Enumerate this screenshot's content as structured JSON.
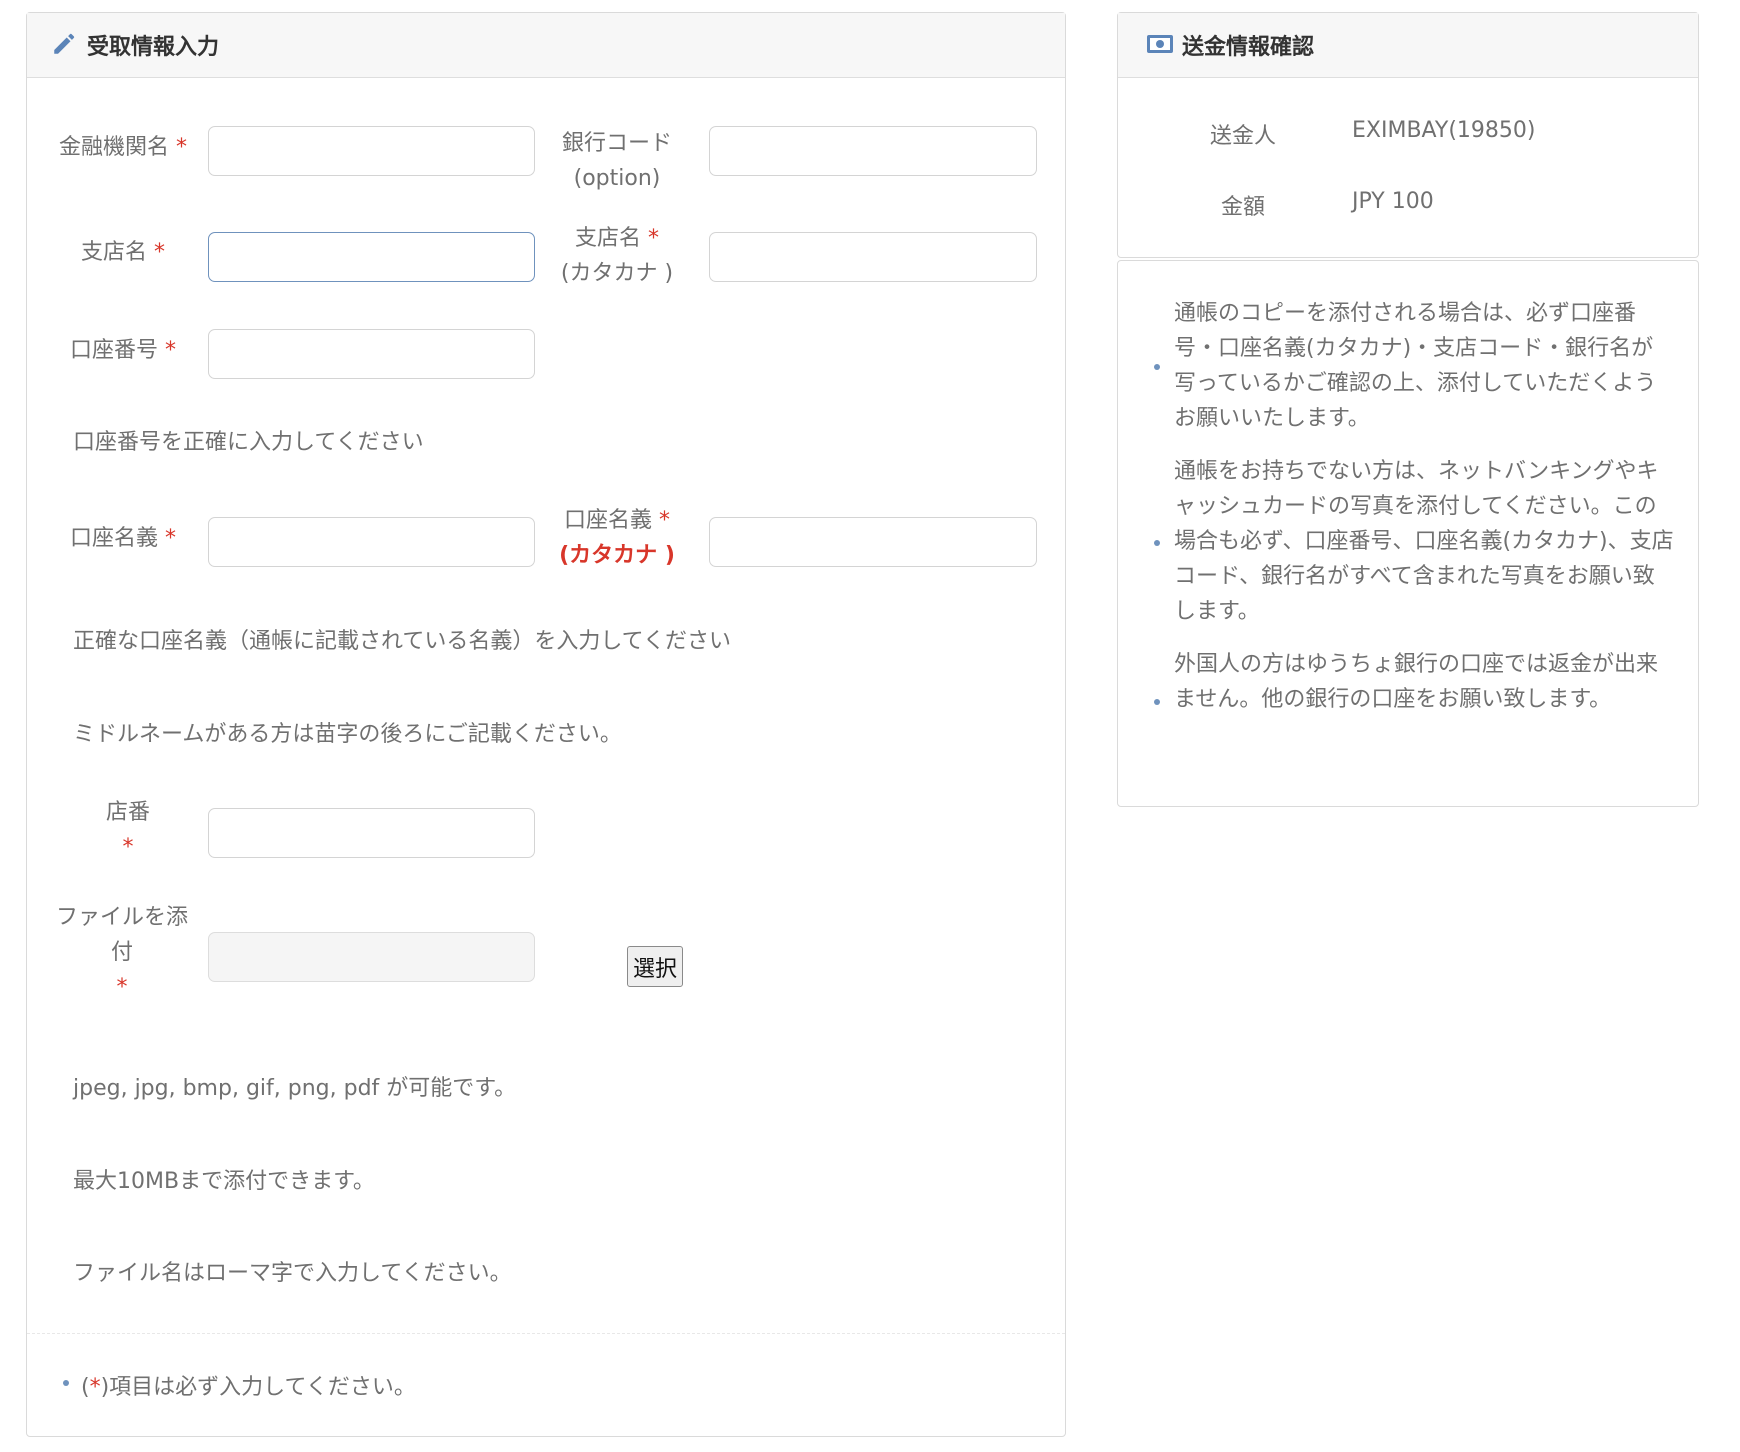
{
  "form": {
    "title": "受取情報入力",
    "required_mark": "*",
    "bank_name_label": "金融機関名",
    "bank_code_label_line1": "銀行コード",
    "bank_code_label_line2": "(option)",
    "branch_name_label": "支店名",
    "branch_kana_label_line1": "支店名",
    "branch_kana_label_line2": "(カタカナ )",
    "account_number_label": "口座番号",
    "account_number_note": "口座番号を正確に入力してください",
    "account_holder_label": "口座名義",
    "account_holder_kana_label_line1": "口座名義",
    "account_holder_kana_label_line2": "(カタカナ )",
    "account_holder_note": "正確な口座名義（通帳に記載されている名義）を入力してください",
    "middle_name_note": "ミドルネームがある方は苗字の後ろにご記載ください。",
    "branch_number_label": "店番",
    "file_label_line1": "ファイルを添",
    "file_label_line2": "付",
    "select_button": "選択",
    "file_types_note": "jpeg, jpg, bmp, gif, png, pdf が可能です。",
    "file_size_note": "最大10MBまで添付できます。",
    "file_name_note": "ファイル名はローマ字で入力してください。",
    "footer_prefix": "(",
    "footer_suffix": ")項目は必ず入力してください。"
  },
  "confirm": {
    "title": "送金情報確認",
    "sender_label": "送金人",
    "sender_value": "EXIMBAY(19850)",
    "amount_label": "金額",
    "amount_value": "JPY 100"
  },
  "notices": [
    "通帳のコピーを添付される場合は、必ず口座番号・口座名義(カタカナ)・支店コード・銀行名が写っているかご確認の上、添付していただくようお願いいたします。",
    "通帳をお持ちでない方は、ネットバンキングやキャッシュカードの写真を添付してください。この場合も必ず、口座番号、口座名義(カタカナ)、支店コード、銀行名がすべて含まれた写真をお願い致します。",
    "外国人の方はゆうちょ銀行の口座では返金が出来ません。他の銀行の口座をお願い致します。"
  ],
  "colors": {
    "accent": "#6f92bd",
    "required": "#d8362a",
    "header_bg": "#f7f7f7"
  },
  "icons": {
    "form_header": "pencil-icon",
    "confirm_header": "money-bill-icon"
  }
}
